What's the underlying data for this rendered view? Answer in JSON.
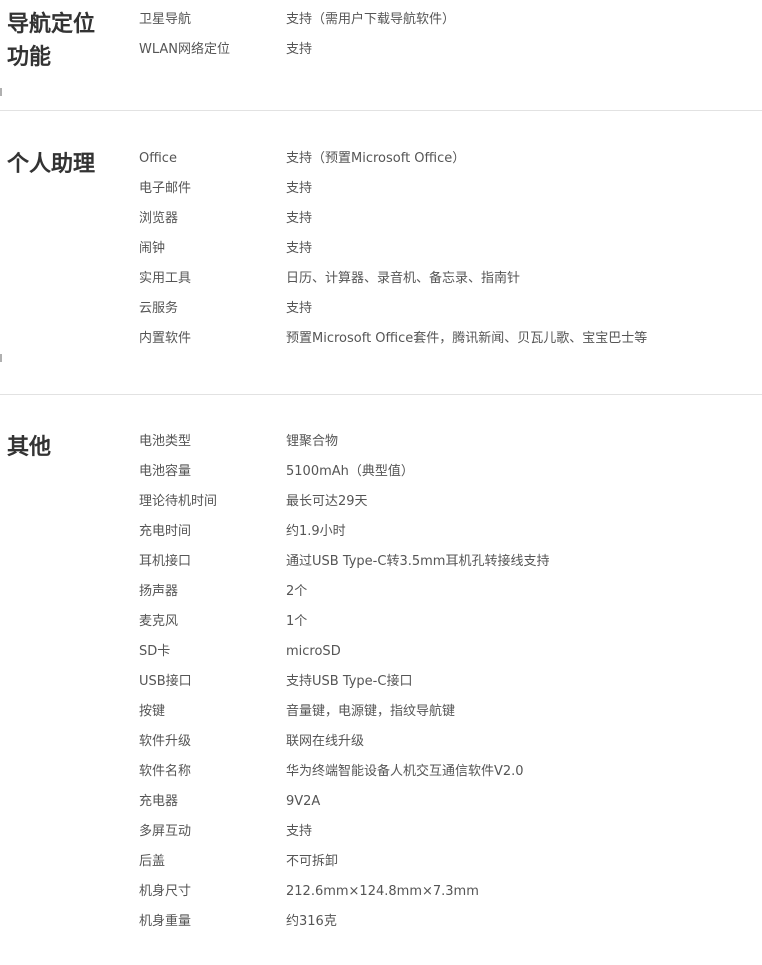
{
  "sections": [
    {
      "title": "导航定位\n功能",
      "rows": [
        {
          "key": "卫星导航",
          "value": "支持（需用户下载导航软件）"
        },
        {
          "key": "WLAN网络定位",
          "value": "支持"
        }
      ]
    },
    {
      "title": "个人助理",
      "rows": [
        {
          "key": "Office",
          "value": "支持（预置Microsoft Office）"
        },
        {
          "key": "电子邮件",
          "value": "支持"
        },
        {
          "key": "浏览器",
          "value": "支持"
        },
        {
          "key": "闹钟",
          "value": "支持"
        },
        {
          "key": "实用工具",
          "value": "日历、计算器、录音机、备忘录、指南针"
        },
        {
          "key": "云服务",
          "value": "支持"
        },
        {
          "key": "内置软件",
          "value": "预置Microsoft Office套件，腾讯新闻、贝瓦儿歌、宝宝巴士等"
        }
      ]
    },
    {
      "title": "其他",
      "rows": [
        {
          "key": "电池类型",
          "value": "锂聚合物"
        },
        {
          "key": "电池容量",
          "value": "5100mAh（典型值）"
        },
        {
          "key": "理论待机时间",
          "value": "最长可达29天"
        },
        {
          "key": "充电时间",
          "value": "约1.9小时"
        },
        {
          "key": "耳机接口",
          "value": "通过USB Type-C转3.5mm耳机孔转接线支持"
        },
        {
          "key": "扬声器",
          "value": "2个"
        },
        {
          "key": "麦克风",
          "value": "1个"
        },
        {
          "key": "SD卡",
          "value": "microSD"
        },
        {
          "key": "USB接口",
          "value": "支持USB Type-C接口"
        },
        {
          "key": "按键",
          "value": "音量键，电源键，指纹导航键"
        },
        {
          "key": "软件升级",
          "value": "联网在线升级"
        },
        {
          "key": "软件名称",
          "value": "华为终端智能设备人机交互通信软件V2.0"
        },
        {
          "key": "充电器",
          "value": "9V2A"
        },
        {
          "key": "多屏互动",
          "value": "支持"
        },
        {
          "key": "后盖",
          "value": "不可拆卸"
        },
        {
          "key": "机身尺寸",
          "value": "212.6mm×124.8mm×7.3mm"
        },
        {
          "key": "机身重量",
          "value": "约316克"
        }
      ]
    }
  ]
}
